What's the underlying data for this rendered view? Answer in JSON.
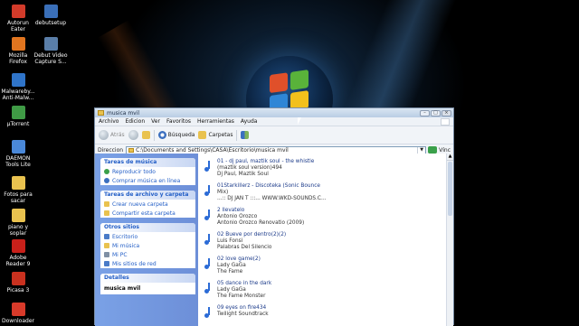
{
  "desktop_icons": [
    {
      "label": "Autorun Eater",
      "icon": "autorun-eater-icon",
      "color": "#d23b2a"
    },
    {
      "label": "debutsetup",
      "icon": "setup-icon",
      "color": "#3a6fb8"
    },
    {
      "label": "Mozilla Firefox",
      "icon": "firefox-icon",
      "color": "#e1751f"
    },
    {
      "label": "Debut Video Capture S...",
      "icon": "video-capture-icon",
      "color": "#5a7ea8"
    },
    {
      "label": "Malwareby... Anti-Malw...",
      "icon": "malwarebytes-icon",
      "color": "#2f74c9"
    },
    {
      "label": "µTorrent",
      "icon": "utorrent-icon",
      "color": "#3f9a45"
    },
    {
      "label": "DAEMON Tools Lite",
      "icon": "daemon-tools-icon",
      "color": "#4a88d8"
    },
    {
      "label": "Fotos para sacar",
      "icon": "folder-icon",
      "color": "#e9c24f"
    },
    {
      "label": "piano y soplar",
      "icon": "folder-icon",
      "color": "#e9c24f"
    },
    {
      "label": "Adobe Reader 9",
      "icon": "adobe-reader-icon",
      "color": "#c8201a"
    },
    {
      "label": "Picasa 3",
      "icon": "picasa-icon",
      "color": "#c9311f"
    },
    {
      "label": "Downloader",
      "icon": "downloader-icon",
      "color": "#d83a2a"
    }
  ],
  "window": {
    "title": "musica mvil",
    "menu": [
      "Archivo",
      "Edicion",
      "Ver",
      "Favoritos",
      "Herramientas",
      "Ayuda"
    ],
    "toolbar": {
      "back": "Atrás",
      "search": "Búsqueda",
      "folders": "Carpetas"
    },
    "address_label": "Direccion",
    "address_value": "C:\\Documents and Settings\\CASA\\Escritorio\\musica mvil",
    "links_label": "Vínc"
  },
  "task_pane": {
    "music_tasks": {
      "header": "Tareas de música",
      "items": [
        "Reproducir todo",
        "Comprar música en línea"
      ]
    },
    "file_tasks": {
      "header": "Tareas de archivo y carpeta",
      "items": [
        "Crear nueva carpeta",
        "Compartir esta carpeta"
      ]
    },
    "other_places": {
      "header": "Otros sitios",
      "items": [
        "Escritorio",
        "Mi música",
        "Mi PC",
        "Mis sitios de red"
      ]
    },
    "details": {
      "header": "Detalles",
      "value": "musica mvil"
    }
  },
  "files": [
    {
      "line1": "01 - dj paul, maztik soul - the whistle",
      "line2": "(maztik soul version)494",
      "line3": "Dj Paul, Maztik Soul"
    },
    {
      "line1": "01Starkillerz - Discoteka (Sonic Bounce",
      "line2": "Mix)",
      "line3": "...:: DJ JAN T :::... WWW.WKD-SOUNDS.C..."
    },
    {
      "line1": "2 llevatelo",
      "line2": "Antonio Orozco",
      "line3": "Antonio Orozco Renovatio (2009)"
    },
    {
      "line1": "02 Bueve por dentro(2)(2)",
      "line2": "Luis Fonsi",
      "line3": "Palabras Del Silencio"
    },
    {
      "line1": "02 love game(2)",
      "line2": "Lady GaGa",
      "line3": "The Fame"
    },
    {
      "line1": "05 dance in the dark",
      "line2": "Lady GaGa",
      "line3": "The Fame Monster"
    },
    {
      "line1": "09 eyes on fire434",
      "line2": "Twilight Soundtrack",
      "line3": ""
    }
  ]
}
